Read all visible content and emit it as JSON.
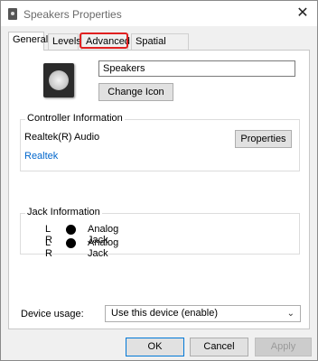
{
  "window": {
    "title": "Speakers Properties",
    "close_glyph": "✕"
  },
  "tabs": [
    {
      "label": "General",
      "selected": true
    },
    {
      "label": "Levels"
    },
    {
      "label": "Advanced",
      "highlighted": true
    },
    {
      "label": "Spatial sound"
    }
  ],
  "general": {
    "device_name": "Speakers",
    "change_icon_label": "Change Icon",
    "controller": {
      "title": "Controller Information",
      "name": "Realtek(R) Audio",
      "properties_label": "Properties",
      "link": "Realtek"
    },
    "jack": {
      "title": "Jack Information",
      "rows": [
        {
          "channels": "L R",
          "label": "Analog Jack"
        },
        {
          "channels": "L R",
          "label": "Analog Jack"
        }
      ]
    }
  },
  "device_usage": {
    "label": "Device usage:",
    "value": "Use this device (enable)"
  },
  "buttons": {
    "ok": "OK",
    "cancel": "Cancel",
    "apply": "Apply"
  },
  "colors": {
    "highlight": "#e02020",
    "link": "#0066cc",
    "default_button_border": "#0078d7"
  }
}
